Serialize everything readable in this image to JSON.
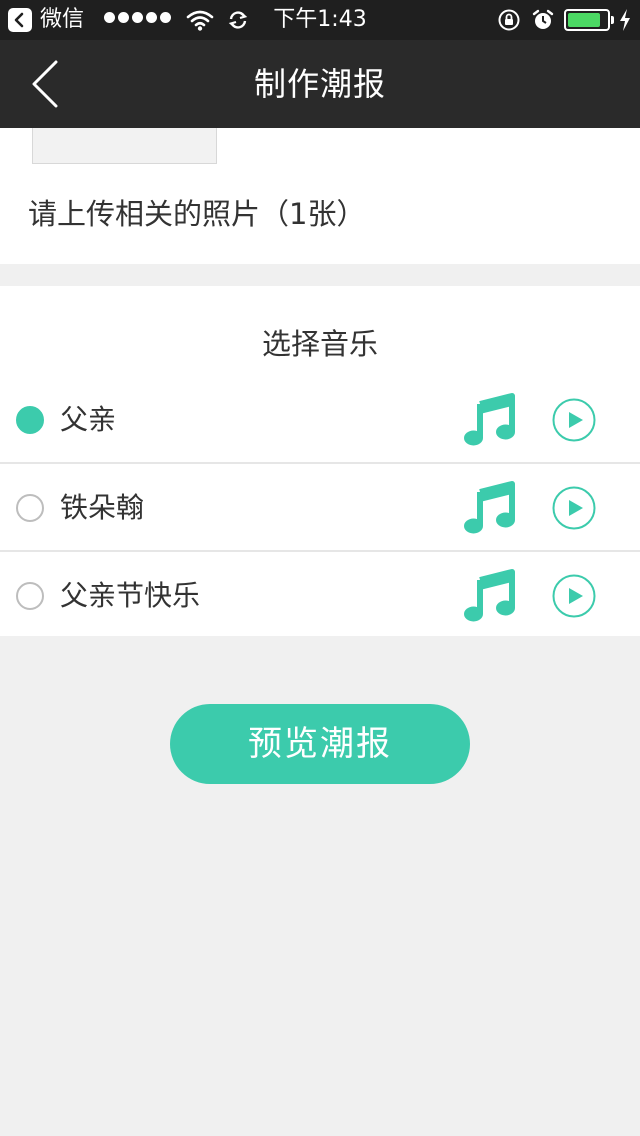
{
  "status_bar": {
    "app_name": "微信",
    "time": "下午1:43",
    "battery_level": 0.85,
    "colors": {
      "background": "#1f1f1f",
      "battery": "#4cd964"
    }
  },
  "nav": {
    "title": "制作潮报",
    "back_icon": "chevron-left-icon"
  },
  "upload": {
    "hint": "请上传相关的照片（1张）"
  },
  "music": {
    "title": "选择音乐",
    "items": [
      {
        "label": "父亲",
        "selected": true
      },
      {
        "label": "铁朵翰",
        "selected": false
      },
      {
        "label": "父亲节快乐",
        "selected": false
      }
    ],
    "note_icon": "music-note-icon",
    "play_icon": "play-circle-icon"
  },
  "preview_button": {
    "label": "预览潮报"
  },
  "colors": {
    "accent": "#3ccbac",
    "page_background": "#f0f0f0",
    "nav_background": "#2a2a2a"
  }
}
